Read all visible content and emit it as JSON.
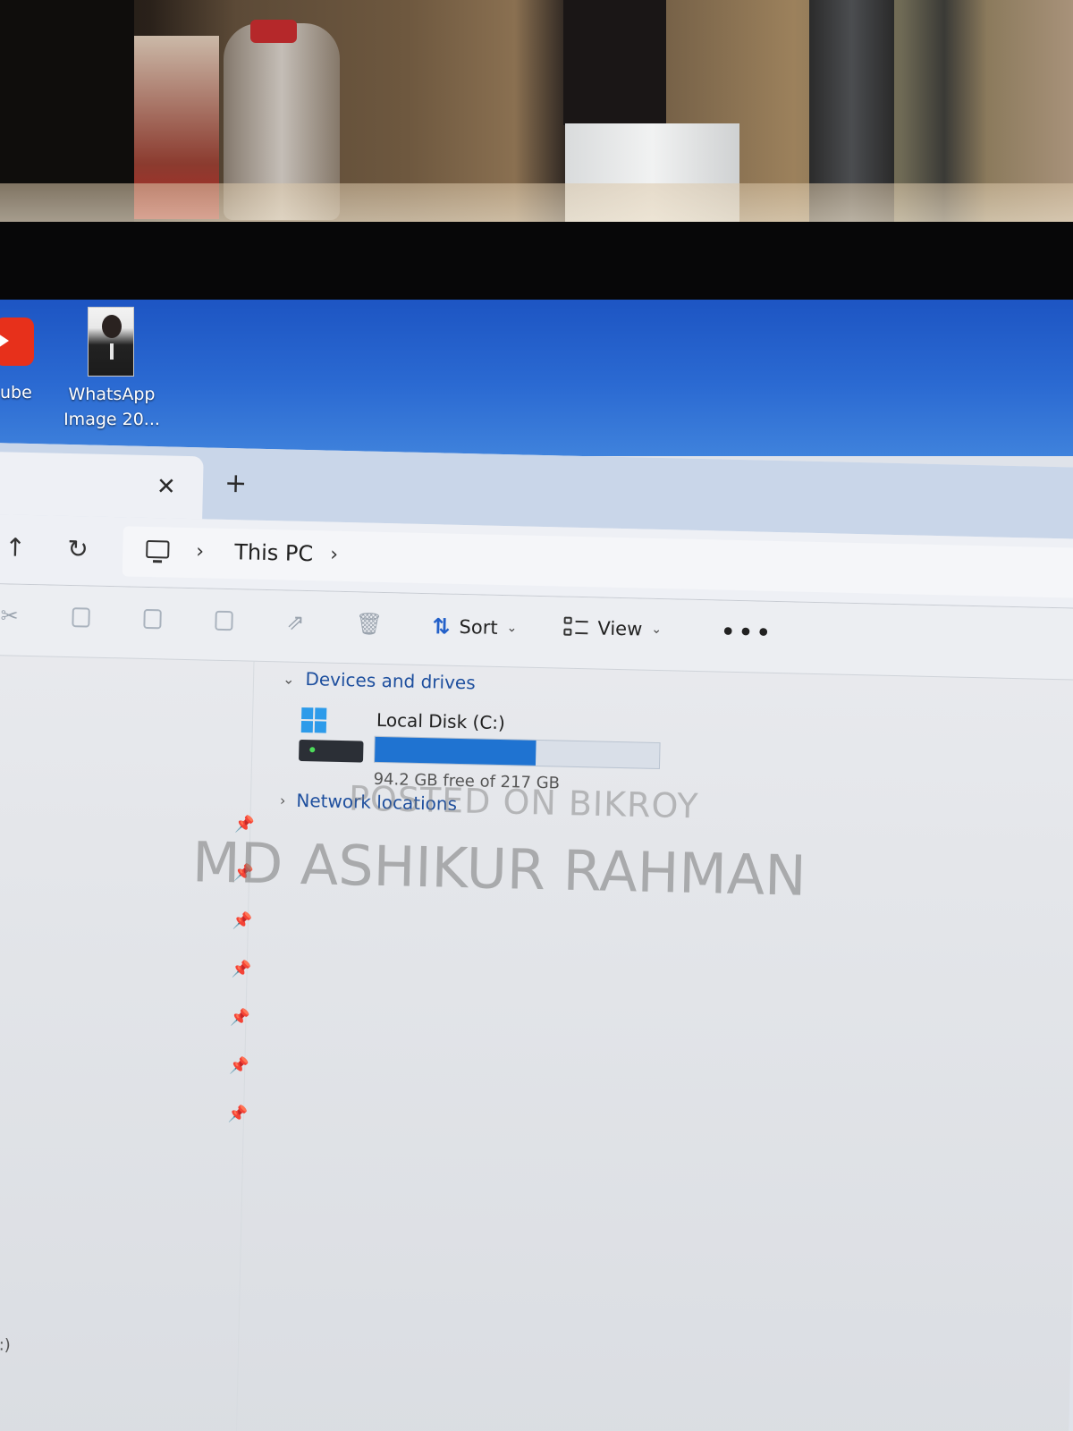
{
  "desktop": {
    "icons": [
      {
        "label": "ube"
      },
      {
        "label_line1": "WhatsApp",
        "label_line2": "Image 20..."
      }
    ]
  },
  "tabbar": {
    "close_glyph": "✕",
    "new_tab_glyph": "+"
  },
  "addressbar": {
    "up_glyph": "↑",
    "refresh_glyph": "↻",
    "separator_glyph": "›",
    "location": "This PC"
  },
  "toolbar": {
    "icons": [
      "cut-icon",
      "copy-icon",
      "paste-icon",
      "rename-icon",
      "share-icon",
      "delete-icon"
    ],
    "sort_label": "Sort",
    "view_label": "View",
    "more_glyph": "•••"
  },
  "content": {
    "devices_header": "Devices and drives",
    "drive": {
      "name": "Local Disk (C:)",
      "free_text": "94.2 GB free of 217 GB",
      "used_fraction": 0.566
    },
    "network_header": "Network locations"
  },
  "nav_pane": {
    "footer_label": "(C:)"
  },
  "watermark": {
    "line1": "POSTED ON BIKROY",
    "line2": "MD ASHIKUR RAHMAN"
  },
  "colors": {
    "desktop_blue": "#2b6ad2",
    "accent": "#1f73d1",
    "link_blue": "#1e4f9e"
  }
}
